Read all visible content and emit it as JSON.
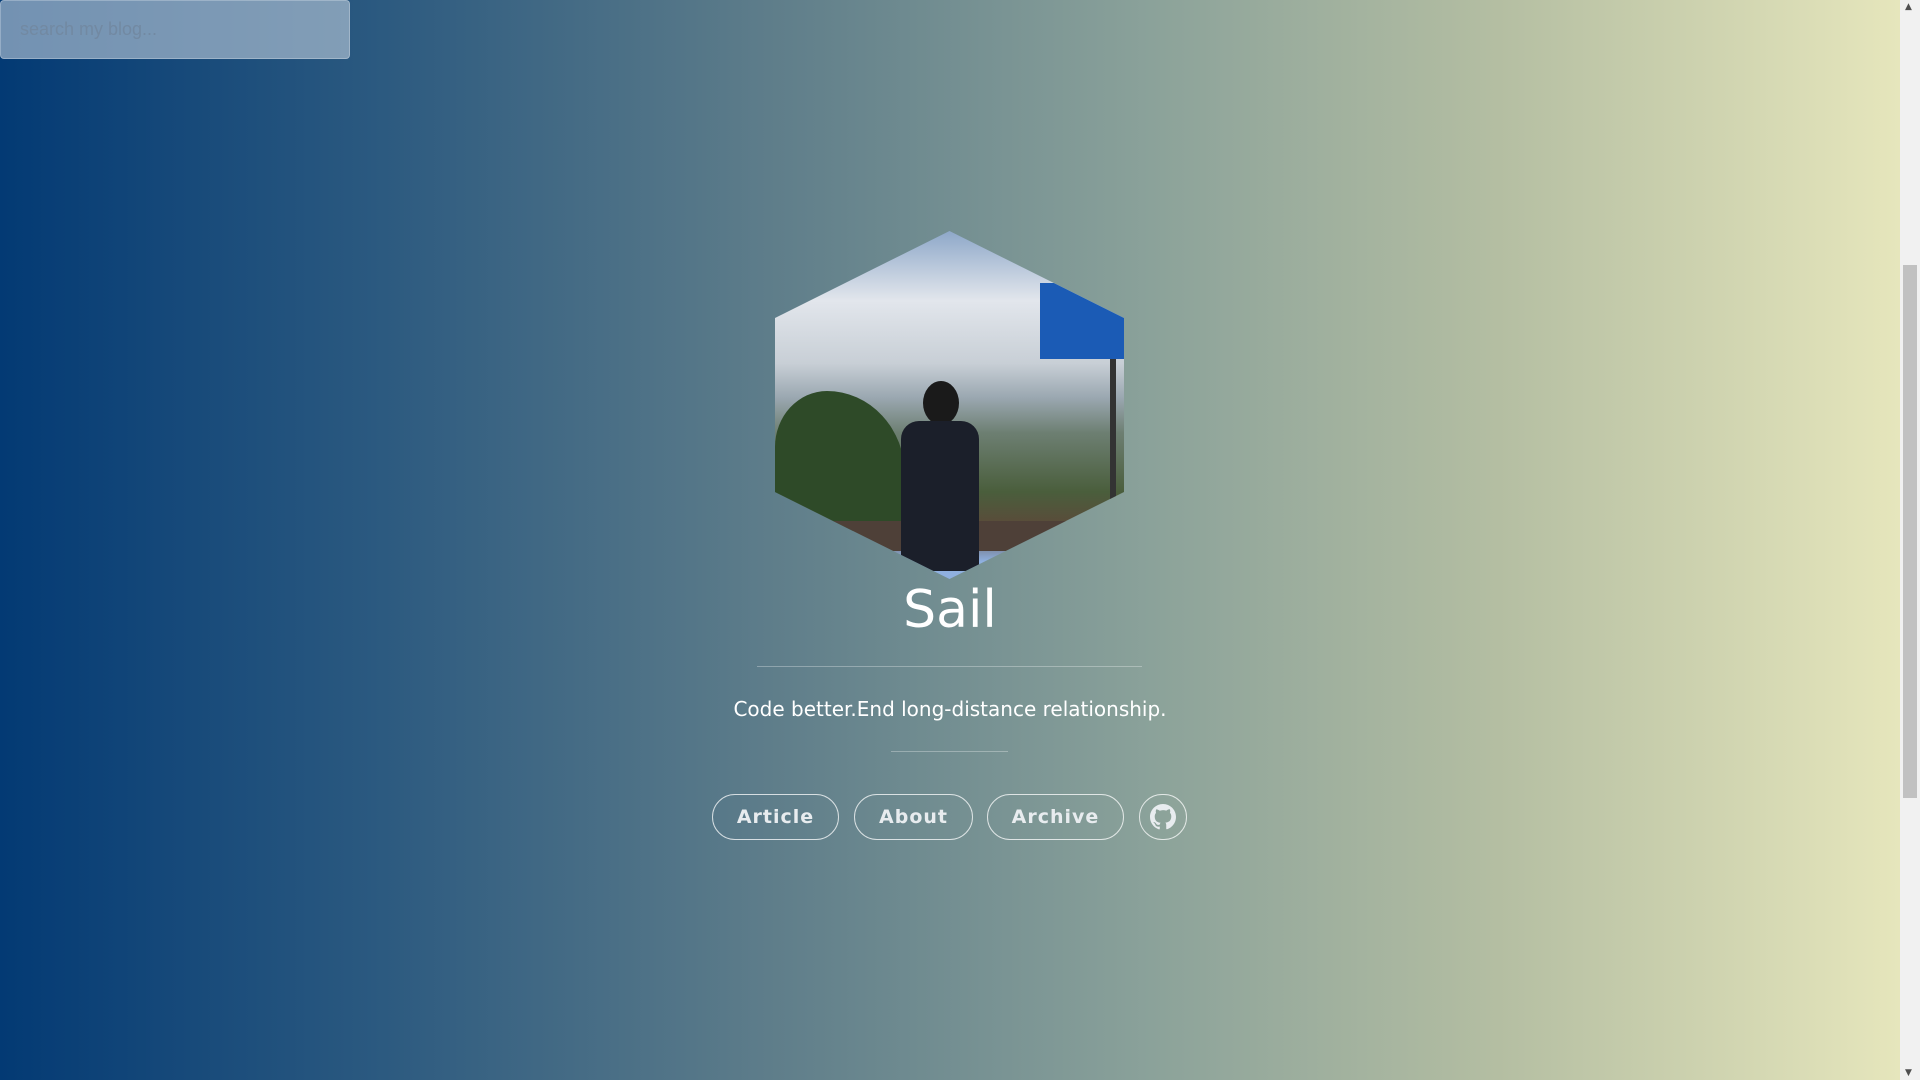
{
  "search": {
    "placeholder": "search my blog..."
  },
  "profile": {
    "name": "Sail",
    "tagline": "Code better.End long-distance relationship."
  },
  "nav": [
    {
      "label": "Article"
    },
    {
      "label": "About"
    },
    {
      "label": "Archive"
    },
    {
      "icon": "github-icon"
    }
  ],
  "colors": {
    "gradient_start": "#033a74",
    "gradient_end": "#e6e6bc"
  }
}
